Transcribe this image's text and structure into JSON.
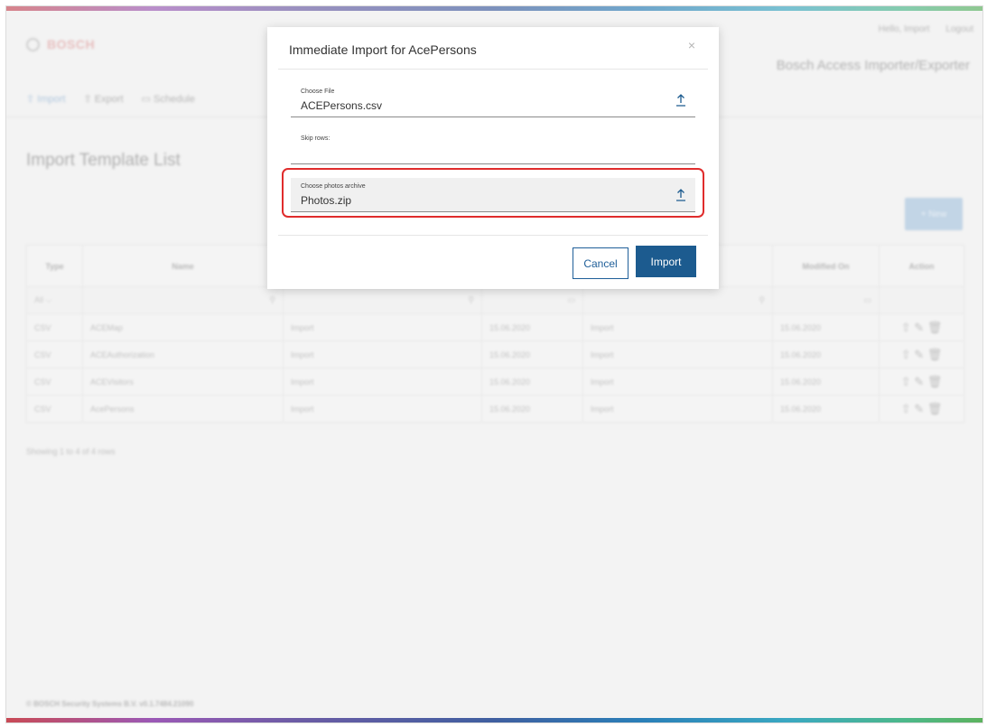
{
  "brand": {
    "logo_text": "BOSCH",
    "app_title": "Bosch Access Importer/Exporter"
  },
  "user": {
    "greeting": "Hello, Import",
    "logout": "Logout"
  },
  "nav": {
    "import": "Import",
    "export": "Export",
    "schedule": "Schedule"
  },
  "page": {
    "title": "Import Template List",
    "new_button": "+ New"
  },
  "table": {
    "headers": {
      "type": "Type",
      "name": "Name",
      "modified_on": "Modified On",
      "action": "Action"
    },
    "filter_all": "All",
    "rows": [
      {
        "type": "CSV",
        "name": "ACEMap",
        "c3": "Import",
        "date1": "15.06.2020",
        "c5": "Import",
        "date2": "15.06.2020"
      },
      {
        "type": "CSV",
        "name": "ACEAuthorization",
        "c3": "Import",
        "date1": "15.06.2020",
        "c5": "Import",
        "date2": "15.06.2020"
      },
      {
        "type": "CSV",
        "name": "ACEVisitors",
        "c3": "Import",
        "date1": "15.06.2020",
        "c5": "Import",
        "date2": "15.06.2020"
      },
      {
        "type": "CSV",
        "name": "AcePersons",
        "c3": "Import",
        "date1": "15.06.2020",
        "c5": "Import",
        "date2": "15.06.2020"
      }
    ],
    "showing": "Showing 1 to 4 of 4 rows"
  },
  "footer": "© BOSCH Security Systems B.V. v0.1.7484.21090",
  "modal": {
    "title": "Immediate Import for AcePersons",
    "close": "×",
    "choose_file": {
      "label": "Choose File",
      "value": "ACEPersons.csv"
    },
    "skip_rows": {
      "label": "Skip rows:",
      "value": ""
    },
    "photos": {
      "label": "Choose photos archive",
      "value": "Photos.zip"
    },
    "cancel": "Cancel",
    "import": "Import"
  },
  "colors": {
    "primary": "#1c5b8f",
    "highlight": "#e02c2c"
  }
}
